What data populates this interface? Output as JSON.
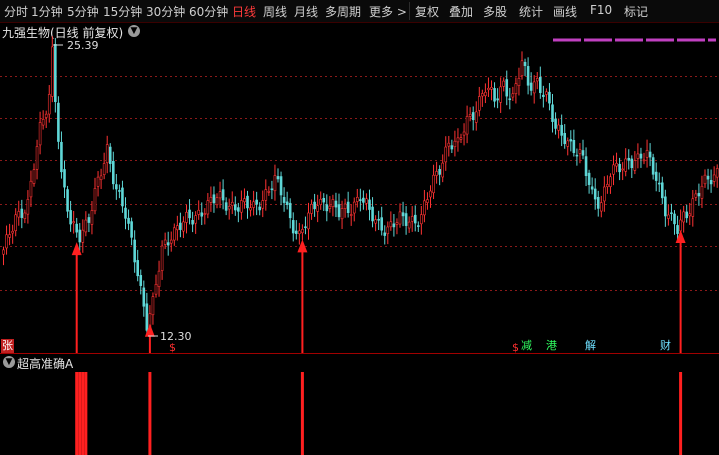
{
  "toolbar": {
    "periods": [
      "分时",
      "1分钟",
      "5分钟",
      "15分钟",
      "30分钟",
      "60分钟",
      "日线",
      "周线",
      "月线",
      "多周期",
      "更多 >"
    ],
    "active_index": 6,
    "tools": [
      "复权",
      "叠加",
      "多股",
      "统计",
      "画线",
      "F10",
      "标记"
    ]
  },
  "chart": {
    "title": "九强生物(日线 前复权)",
    "high_label": "25.39",
    "low_label": "12.30",
    "colors": {
      "up": "#ff3333",
      "down": "#5fd7d7",
      "signal": "#ff2020",
      "grid": "#8b1a1a",
      "border": "#9b0000",
      "accent": "#c040c0"
    }
  },
  "events": {
    "zhang": "张",
    "s1": "$",
    "s2": "$",
    "jian": "减",
    "gang": "港",
    "jie": "解",
    "cai": "财"
  },
  "indicator": {
    "title": "超高准确A"
  },
  "chart_data": {
    "type": "candlestick",
    "y_range": [
      12.3,
      25.39
    ],
    "price_max": 25.39,
    "price_min": 12.3,
    "signal_arrows_at_candle": [
      24,
      48,
      98,
      222
    ],
    "indicator_bars_at_candle": [
      24,
      25,
      26,
      27,
      48,
      98,
      222
    ]
  }
}
